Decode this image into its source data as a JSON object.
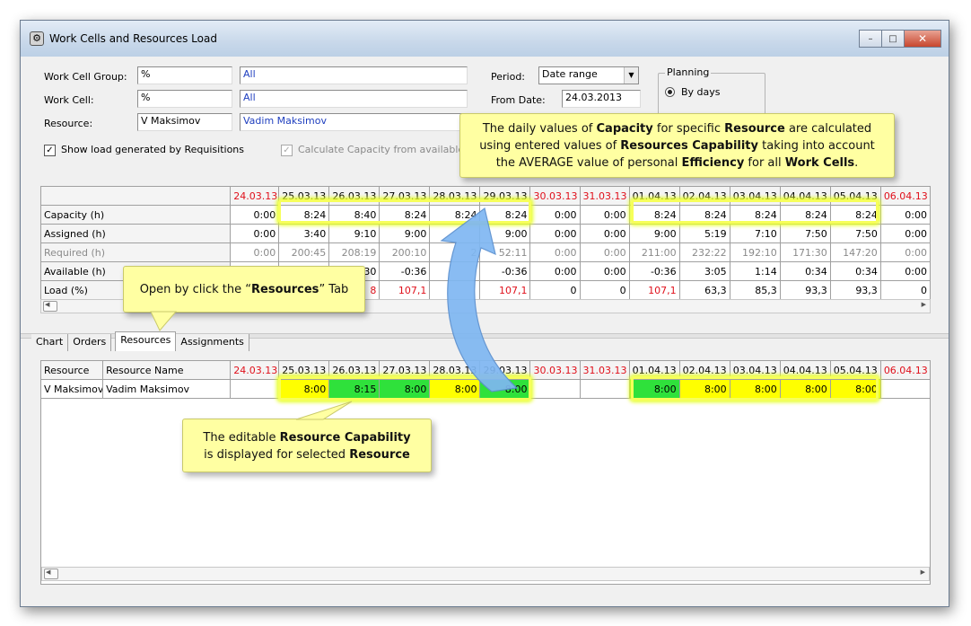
{
  "window": {
    "title": "Work Cells and Resources Load",
    "controls": {
      "minimize": "–",
      "maximize": "□",
      "close": "✕"
    }
  },
  "filters": {
    "work_cell_group": {
      "label": "Work Cell Group:",
      "code": "%",
      "name": "All"
    },
    "work_cell": {
      "label": "Work Cell:",
      "code": "%",
      "name": "All"
    },
    "resource": {
      "label": "Resource:",
      "code": "V Maksimov",
      "name": "Vadim Maksimov"
    },
    "show_load_label": "Show load generated by Requisitions",
    "calc_capacity_label": "Calculate Capacity from available R"
  },
  "period": {
    "label": "Period:",
    "value": "Date range",
    "from_label": "From Date:",
    "from_value": "24.03.2013"
  },
  "planning": {
    "title": "Planning",
    "option": "By days"
  },
  "load_grid": {
    "dates": [
      "24.03.13",
      "25.03.13",
      "26.03.13",
      "27.03.13",
      "28.03.13",
      "29.03.13",
      "30.03.13",
      "31.03.13",
      "01.04.13",
      "02.04.13",
      "03.04.13",
      "04.04.13",
      "05.04.13",
      "06.04.13"
    ],
    "weekend_flags": [
      true,
      false,
      false,
      false,
      false,
      false,
      true,
      true,
      false,
      false,
      false,
      false,
      false,
      true
    ],
    "rows": [
      {
        "name": "Capacity (h)",
        "values": [
          "0:00",
          "8:24",
          "8:40",
          "8:24",
          "8:24",
          "8:24",
          "0:00",
          "0:00",
          "8:24",
          "8:24",
          "8:24",
          "8:24",
          "8:24",
          "0:00"
        ]
      },
      {
        "name": "Assigned (h)",
        "values": [
          "0:00",
          "3:40",
          "9:10",
          "9:00",
          "",
          "9:00",
          "0:00",
          "0:00",
          "9:00",
          "5:19",
          "7:10",
          "7:50",
          "7:50",
          "0:00"
        ]
      },
      {
        "name": "Required (h)",
        "values": [
          "0:00",
          "200:45",
          "208:19",
          "200:10",
          "2",
          "52:11",
          "0:00",
          "0:00",
          "211:00",
          "232:22",
          "192:10",
          "171:30",
          "147:20",
          "0:00"
        ]
      },
      {
        "name": "Available (h)",
        "values": [
          "",
          "",
          "30",
          "-0:36",
          "",
          "-0:36",
          "0:00",
          "0:00",
          "-0:36",
          "3:05",
          "1:14",
          "0:34",
          "0:34",
          "0:00"
        ]
      },
      {
        "name": "Load (%)",
        "values": [
          "",
          "",
          "8",
          "107,1",
          "",
          "107,1",
          "0",
          "0",
          "107,1",
          "63,3",
          "85,3",
          "93,3",
          "93,3",
          "0"
        ]
      }
    ]
  },
  "tabs": [
    {
      "label": "Chart"
    },
    {
      "label": "Orders"
    },
    {
      "label": "Resources"
    },
    {
      "label": "Assignments"
    }
  ],
  "resource_grid": {
    "col_resource": "Resource",
    "col_name": "Resource Name",
    "row": {
      "resource": "V Maksimov",
      "name": "Vadim Maksimov"
    },
    "values": [
      "",
      "8:00",
      "8:15",
      "8:00",
      "8:00",
      "8:00",
      "",
      "",
      "8:00",
      "8:00",
      "8:00",
      "8:00",
      "8:00",
      ""
    ],
    "colors": [
      "",
      "yellow",
      "green",
      "green",
      "yellow",
      "green",
      "",
      "",
      "green",
      "yellow",
      "yellow",
      "yellow",
      "yellow",
      ""
    ]
  },
  "callouts": {
    "capacity": {
      "line1": [
        "The daily values of ",
        "Capacity",
        " for specific ",
        "Resource",
        " are calculated"
      ],
      "line2": [
        "using entered values of ",
        "Resources Capability",
        " taking into account"
      ],
      "line3": [
        "the AVERAGE value of personal ",
        "Efficiency",
        " for all ",
        "Work Cells",
        "."
      ]
    },
    "resources_tab": {
      "parts": [
        "Open by click the “",
        "Resources",
        "” Tab"
      ]
    },
    "capability": {
      "line1": [
        "The editable ",
        "Resource Capability"
      ],
      "line2": [
        "is displayed for selected ",
        "Resource"
      ]
    }
  },
  "icons": {
    "app": "gear-icon",
    "dropdown": "chevron-down-icon",
    "scroll_left": "arrow-left-icon",
    "scroll_right": "arrow-right-icon"
  },
  "colors": {
    "weekend_red": "#e0101b",
    "capability_yellow": "#ffff00",
    "capability_green": "#2fe13b",
    "callout_bg": "#ffffa2",
    "arrow_blue": "#7fb7f2"
  }
}
